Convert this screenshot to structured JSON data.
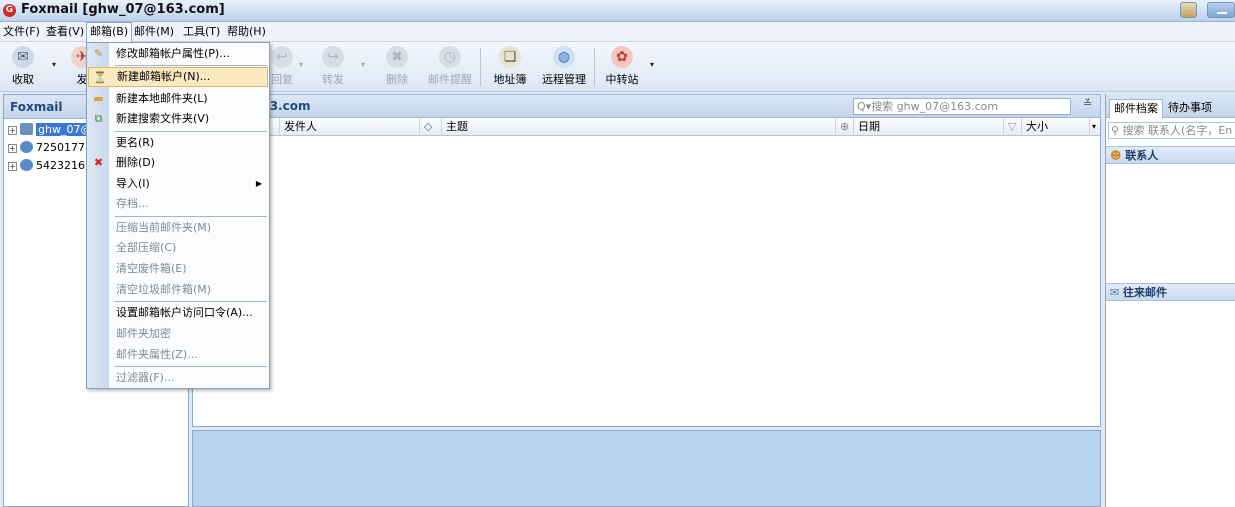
{
  "window": {
    "title": "Foxmail [ghw_07@163.com]",
    "app_icon": "foxmail-logo-icon"
  },
  "menubar": {
    "items": [
      "文件(F)",
      "查看(V)",
      "邮箱(B)",
      "邮件(M)",
      "工具(T)",
      "帮助(H)"
    ],
    "active": "邮箱(B)"
  },
  "toolbar": {
    "items": [
      {
        "label": "收取",
        "icon": "receive-icon",
        "enabled": true
      },
      {
        "label": "发",
        "icon": "send-icon",
        "enabled": true
      },
      {
        "label": "回复",
        "icon": "reply-icon",
        "enabled": false
      },
      {
        "label": "转发",
        "icon": "forward-icon",
        "enabled": false
      },
      {
        "label": "删除",
        "icon": "delete-icon",
        "enabled": false
      },
      {
        "label": "邮件提醒",
        "icon": "reminder-clock-icon",
        "enabled": false
      },
      {
        "label": "地址簿",
        "icon": "address-book-icon",
        "enabled": true
      },
      {
        "label": "远程管理",
        "icon": "remote-globe-icon",
        "enabled": true
      },
      {
        "label": "中转站",
        "icon": "transfer-station-icon",
        "enabled": true
      }
    ]
  },
  "left": {
    "header": "Foxmail",
    "accounts": [
      "ghw_07@",
      "7250177",
      "5423216"
    ],
    "selected": "ghw_07@"
  },
  "main": {
    "address": "163.com",
    "search_placeholder": "搜索 ghw_07@163.com",
    "columns": [
      "发件人",
      "主题",
      "日期",
      "大小"
    ]
  },
  "right": {
    "tabs": [
      "邮件档案",
      "待办事项"
    ],
    "active_tab": "邮件档案",
    "search_placeholder": "搜索 联系人(名字，En",
    "contacts_label": "联系人",
    "recent_mail_label": "往来邮件"
  },
  "dropdown": {
    "items": [
      {
        "label": "修改邮箱帐户属性(P)...",
        "enabled": true,
        "icon": "account-properties-icon"
      },
      {
        "label": "新建邮箱帐户(N)...",
        "enabled": true,
        "icon": "new-account-icon",
        "highlighted": true
      },
      {
        "label": "新建本地邮件夹(L)",
        "enabled": true,
        "icon": "folder-icon"
      },
      {
        "label": "新建搜索文件夹(V)",
        "enabled": true,
        "icon": "search-folder-icon"
      },
      {
        "label": "更名(R)",
        "enabled": true
      },
      {
        "label": "删除(D)",
        "enabled": true,
        "icon": "red-x-icon"
      },
      {
        "label": "导入(I)",
        "enabled": true,
        "submenu": true
      },
      {
        "label": "存档...",
        "enabled": false
      },
      {
        "label": "压缩当前邮件夹(M)",
        "enabled": false
      },
      {
        "label": "全部压缩(C)",
        "enabled": false
      },
      {
        "label": "清空废件箱(E)",
        "enabled": false
      },
      {
        "label": "清空垃圾邮件箱(M)",
        "enabled": false
      },
      {
        "label": "设置邮箱帐户访问口令(A)...",
        "enabled": true
      },
      {
        "label": "邮件夹加密",
        "enabled": false
      },
      {
        "label": "邮件夹属性(Z)...",
        "enabled": false
      },
      {
        "label": "过滤器(F)...",
        "enabled": false
      }
    ]
  },
  "colors": {
    "selection": "#3c78cf",
    "menu_highlight": "#fbe9c2",
    "preview": "#b7d2ef"
  }
}
